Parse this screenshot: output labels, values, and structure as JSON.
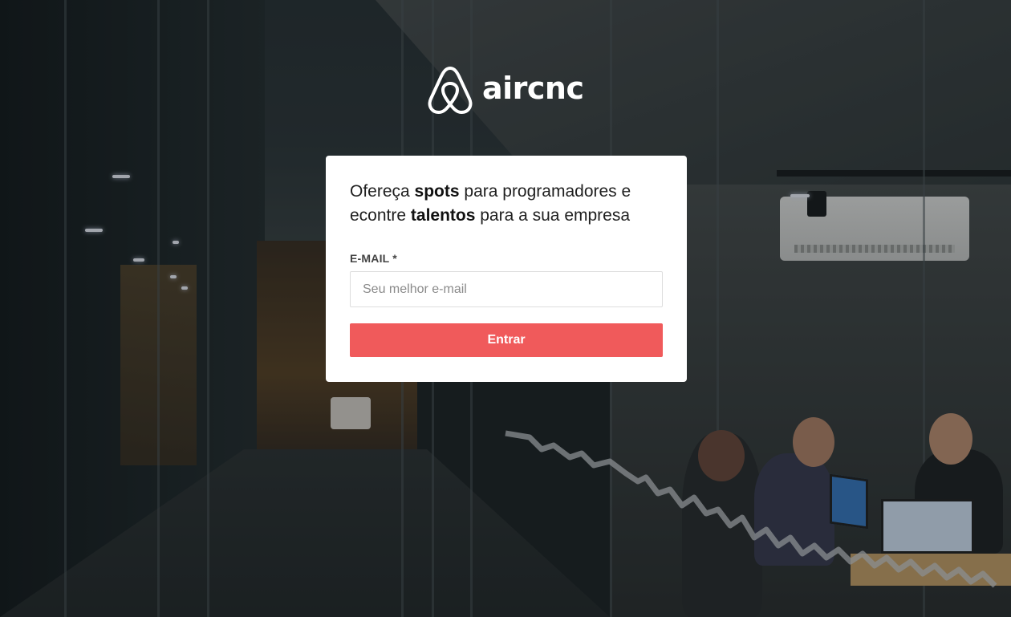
{
  "brand": {
    "name": "aircnc",
    "logo_icon": "airbnb-belo-icon",
    "color": "#ffffff"
  },
  "login_card": {
    "headline": {
      "part1": "Ofereça ",
      "bold1": "spots",
      "part2": " para programadores e econtre ",
      "bold2": "talentos",
      "part3": " para a sua empresa"
    },
    "email": {
      "label": "E-MAIL *",
      "placeholder": "Seu melhor e-mail",
      "value": ""
    },
    "submit_label": "Entrar"
  },
  "colors": {
    "accent": "#f05a5b",
    "card_background": "#ffffff",
    "input_border": "#dddddd",
    "label_text": "#444444"
  }
}
